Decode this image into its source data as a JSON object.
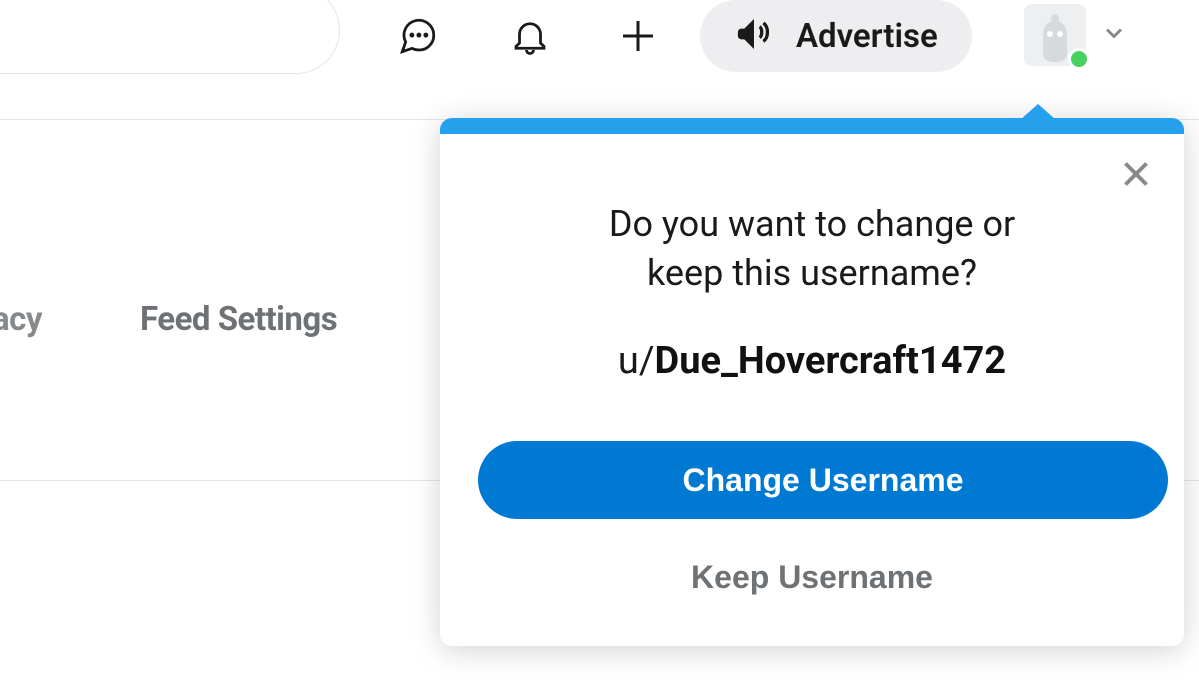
{
  "header": {
    "advertise_label": "Advertise"
  },
  "tabs": {
    "privacy": "acy",
    "feed_settings": "Feed Settings"
  },
  "popover": {
    "prompt_line1": "Do you want to change or",
    "prompt_line2": "keep this username?",
    "username_prefix": "u/",
    "username": "Due_Hovercraft1472",
    "change_label": "Change Username",
    "keep_label": "Keep Username"
  }
}
